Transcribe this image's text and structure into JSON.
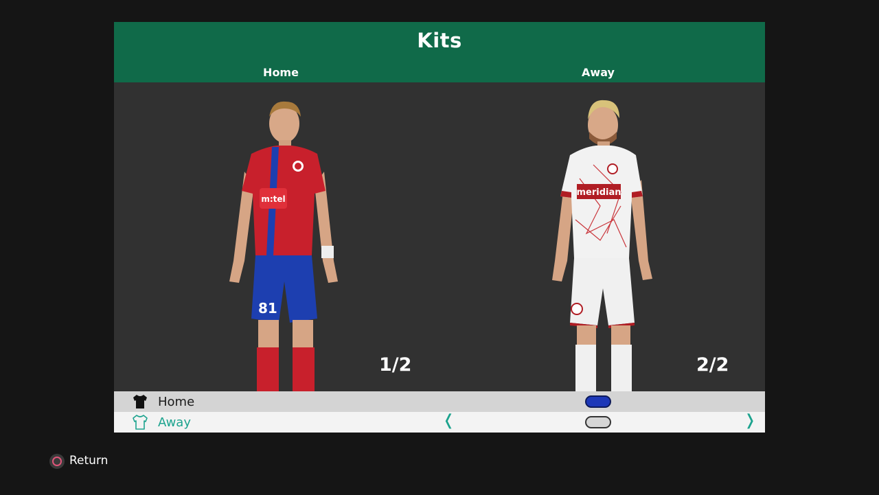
{
  "screen": {
    "title": "Kits",
    "columns": {
      "home": "Home",
      "away": "Away"
    }
  },
  "kits": {
    "home": {
      "page": "1/2",
      "shirt_color": "#c8202c",
      "stripe_color": "#1d3fb0",
      "shorts_color": "#1d3fb0",
      "socks_color": "#c8202c",
      "sponsor": "m:tel",
      "number": "81"
    },
    "away": {
      "page": "2/2",
      "shirt_color": "#f2f2f2",
      "trim_color": "#b01d24",
      "shorts_color": "#f0f0f0",
      "socks_color": "#f0f0f0",
      "sponsor": "meridian"
    }
  },
  "options": [
    {
      "label": "Home",
      "icon": "shirt-filled-icon",
      "toggle_color": "#1d38b8"
    },
    {
      "label": "Away",
      "icon": "shirt-outline-icon",
      "toggle_color": "#d6d6d6",
      "selected": true
    }
  ],
  "arrows": {
    "left": "❬",
    "right": "❭"
  },
  "footer": {
    "return_label": "Return",
    "return_icon": "circle-button-icon"
  }
}
